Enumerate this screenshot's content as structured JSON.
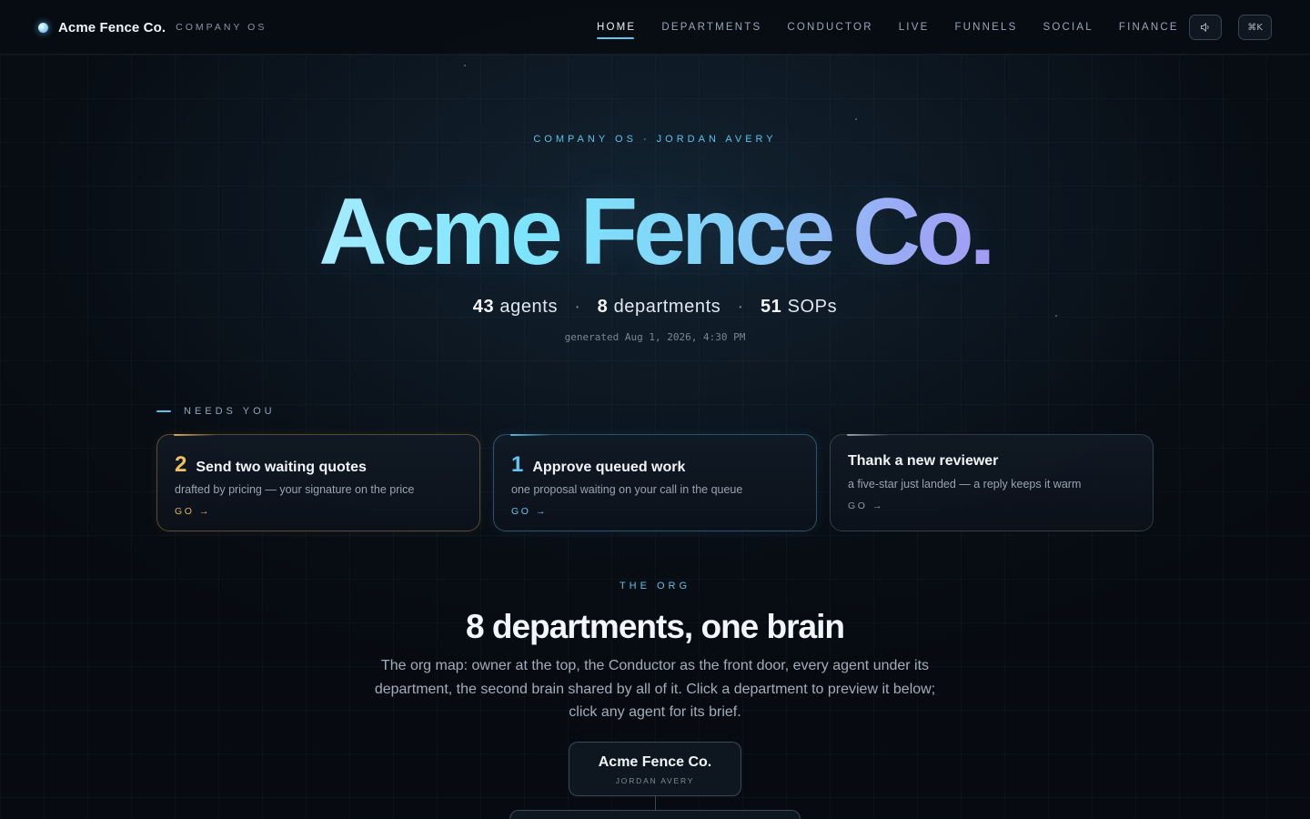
{
  "nav": {
    "brand_name": "Acme Fence Co.",
    "brand_sub": "COMPANY OS",
    "links": [
      {
        "label": "HOME",
        "active": true
      },
      {
        "label": "DEPARTMENTS",
        "active": false
      },
      {
        "label": "CONDUCTOR",
        "active": false
      },
      {
        "label": "LIVE",
        "active": false
      },
      {
        "label": "FUNNELS",
        "active": false
      },
      {
        "label": "SOCIAL",
        "active": false
      },
      {
        "label": "FINANCE",
        "active": false
      }
    ],
    "sound_icon": "speaker-icon",
    "command_label": "⌘K"
  },
  "hero": {
    "eyebrow": "COMPANY OS · JORDAN AVERY",
    "title_part1": "Acme ",
    "title_part2": "Fence ",
    "title_part3": "Co.",
    "stats": {
      "agents_count": "43",
      "agents_label": "agents",
      "departments_count": "8",
      "departments_label": "departments",
      "sops_count": "51",
      "sops_label": "SOPs",
      "separator": "·"
    },
    "generated": "generated Aug 1, 2026, 4:30 PM"
  },
  "needs_you": {
    "label": "NEEDS YOU",
    "cards": [
      {
        "count": "2",
        "title": "Send two waiting quotes",
        "desc": "drafted by pricing — your signature on the price",
        "go": "GO →",
        "accent": "#f0c160"
      },
      {
        "count": "1",
        "title": "Approve queued work",
        "desc": "one proposal waiting on your call in the queue",
        "go": "GO →",
        "accent": "#5fc7f0"
      },
      {
        "count": "",
        "title": "Thank a new reviewer",
        "desc": "a five-star just landed — a reply keeps it warm",
        "go": "GO →",
        "accent": "#8d99a8"
      }
    ]
  },
  "org": {
    "eyebrow": "THE ORG",
    "title": "8 departments, one brain",
    "desc": "The org map: owner at the top, the Conductor as the front door, every agent under its department, the second brain shared by all of it. Click a department to preview it below; click any agent for its brief.",
    "owner_name": "Acme Fence Co.",
    "owner_sub": "JORDAN AVERY"
  },
  "colors": {
    "accent": "#5fc7f0",
    "warning": "#f0c160",
    "background": "#080d14"
  }
}
